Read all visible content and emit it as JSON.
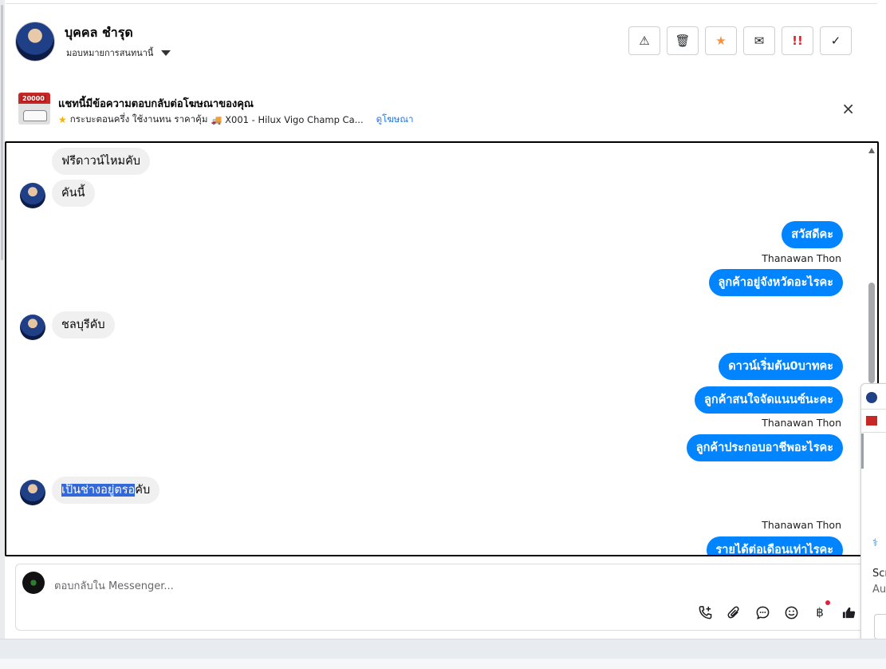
{
  "header": {
    "contact_name": "บุคคล ชำรุด",
    "assign_label": "มอบหมายการสนทนานี้",
    "toolbar": [
      {
        "name": "report-spam-button",
        "icon": "warning-icon",
        "glyph": "⚠"
      },
      {
        "name": "delete-button",
        "icon": "trash-icon",
        "glyph": "🗑"
      },
      {
        "name": "star-button",
        "icon": "star-icon",
        "glyph": "★"
      },
      {
        "name": "mark-unread-button",
        "icon": "envelope-open-icon",
        "glyph": "✉"
      },
      {
        "name": "mark-urgent-button",
        "icon": "double-exclamation-icon",
        "glyph": "!!"
      },
      {
        "name": "mark-done-button",
        "icon": "check-icon",
        "glyph": "✓"
      }
    ]
  },
  "ad_banner": {
    "thumb_badge": "20000",
    "title": "แชทนี้มีข้อความตอบกลับต่อโฆษณาของคุณ",
    "subtitle": "กระบะตอนครึ่ง ใช้งานทน ราคาคุ้ม",
    "subtitle_code": "X001 - Hilux Vigo Champ Ca...",
    "link": "ดูโฆษณา",
    "close": "×"
  },
  "messages": [
    {
      "dir": "in",
      "text": "ฟรีดาวน์ไหมคับ"
    },
    {
      "dir": "in",
      "text": "คันนี้"
    },
    {
      "dir": "out",
      "text": "สวัสดีคะ"
    },
    {
      "dir": "sender",
      "text": "Thanawan Thon"
    },
    {
      "dir": "out",
      "text": "ลูกค้าอยู่จังหวัดอะไรคะ"
    },
    {
      "dir": "in",
      "text": "ชลบุรีคับ"
    },
    {
      "dir": "out",
      "text": "ดาวน์เริ่มต้น0บาทคะ"
    },
    {
      "dir": "out",
      "text": "ลูกค้าสนใจจัดแนนซ์นะคะ"
    },
    {
      "dir": "sender",
      "text": "Thanawan Thon"
    },
    {
      "dir": "out",
      "text": "ลูกค้าประกอบอาชีพอะไรคะ"
    },
    {
      "dir": "in",
      "text_selected": "เป็นช่างอยู่ตรอ",
      "text_rest": "คับ"
    },
    {
      "dir": "sender",
      "text": "Thanawan Thon"
    },
    {
      "dir": "out",
      "text": "รายได้ต่อเดือนเท่าไรคะ"
    }
  ],
  "composer": {
    "placeholder": "ตอบกลับใน Messenger...",
    "icons": [
      "add-call-icon",
      "paperclip-icon",
      "chat-bubble-icon",
      "emoji-icon",
      "baht-icon",
      "thumbs-up-icon"
    ]
  },
  "side_panel": {
    "text1": "Scr",
    "text2": "Au"
  },
  "colors": {
    "outgoing": "#0084ff",
    "incoming": "#f0f0f0",
    "link": "#1877f2",
    "star": "#f7923a",
    "urgent": "#e4202b"
  }
}
